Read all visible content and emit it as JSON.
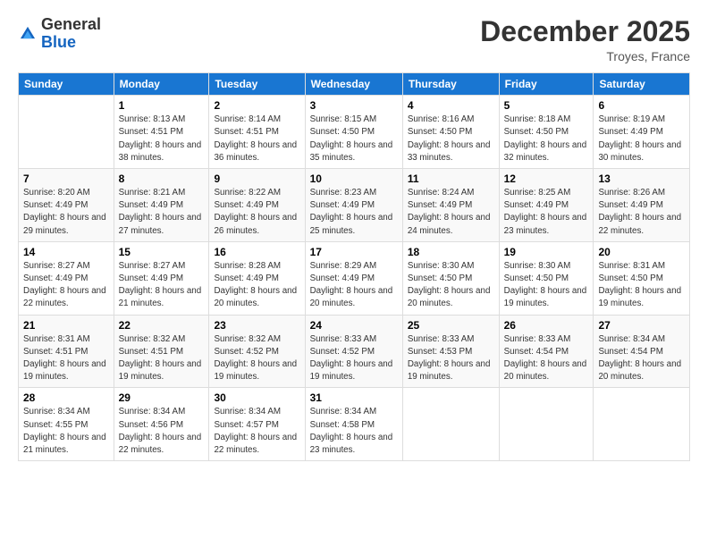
{
  "logo": {
    "general": "General",
    "blue": "Blue"
  },
  "header": {
    "title": "December 2025",
    "location": "Troyes, France"
  },
  "days_of_week": [
    "Sunday",
    "Monday",
    "Tuesday",
    "Wednesday",
    "Thursday",
    "Friday",
    "Saturday"
  ],
  "weeks": [
    [
      {
        "day": null
      },
      {
        "day": "1",
        "sunrise": "Sunrise: 8:13 AM",
        "sunset": "Sunset: 4:51 PM",
        "daylight": "Daylight: 8 hours and 38 minutes."
      },
      {
        "day": "2",
        "sunrise": "Sunrise: 8:14 AM",
        "sunset": "Sunset: 4:51 PM",
        "daylight": "Daylight: 8 hours and 36 minutes."
      },
      {
        "day": "3",
        "sunrise": "Sunrise: 8:15 AM",
        "sunset": "Sunset: 4:50 PM",
        "daylight": "Daylight: 8 hours and 35 minutes."
      },
      {
        "day": "4",
        "sunrise": "Sunrise: 8:16 AM",
        "sunset": "Sunset: 4:50 PM",
        "daylight": "Daylight: 8 hours and 33 minutes."
      },
      {
        "day": "5",
        "sunrise": "Sunrise: 8:18 AM",
        "sunset": "Sunset: 4:50 PM",
        "daylight": "Daylight: 8 hours and 32 minutes."
      },
      {
        "day": "6",
        "sunrise": "Sunrise: 8:19 AM",
        "sunset": "Sunset: 4:49 PM",
        "daylight": "Daylight: 8 hours and 30 minutes."
      }
    ],
    [
      {
        "day": "7",
        "sunrise": "Sunrise: 8:20 AM",
        "sunset": "Sunset: 4:49 PM",
        "daylight": "Daylight: 8 hours and 29 minutes."
      },
      {
        "day": "8",
        "sunrise": "Sunrise: 8:21 AM",
        "sunset": "Sunset: 4:49 PM",
        "daylight": "Daylight: 8 hours and 27 minutes."
      },
      {
        "day": "9",
        "sunrise": "Sunrise: 8:22 AM",
        "sunset": "Sunset: 4:49 PM",
        "daylight": "Daylight: 8 hours and 26 minutes."
      },
      {
        "day": "10",
        "sunrise": "Sunrise: 8:23 AM",
        "sunset": "Sunset: 4:49 PM",
        "daylight": "Daylight: 8 hours and 25 minutes."
      },
      {
        "day": "11",
        "sunrise": "Sunrise: 8:24 AM",
        "sunset": "Sunset: 4:49 PM",
        "daylight": "Daylight: 8 hours and 24 minutes."
      },
      {
        "day": "12",
        "sunrise": "Sunrise: 8:25 AM",
        "sunset": "Sunset: 4:49 PM",
        "daylight": "Daylight: 8 hours and 23 minutes."
      },
      {
        "day": "13",
        "sunrise": "Sunrise: 8:26 AM",
        "sunset": "Sunset: 4:49 PM",
        "daylight": "Daylight: 8 hours and 22 minutes."
      }
    ],
    [
      {
        "day": "14",
        "sunrise": "Sunrise: 8:27 AM",
        "sunset": "Sunset: 4:49 PM",
        "daylight": "Daylight: 8 hours and 22 minutes."
      },
      {
        "day": "15",
        "sunrise": "Sunrise: 8:27 AM",
        "sunset": "Sunset: 4:49 PM",
        "daylight": "Daylight: 8 hours and 21 minutes."
      },
      {
        "day": "16",
        "sunrise": "Sunrise: 8:28 AM",
        "sunset": "Sunset: 4:49 PM",
        "daylight": "Daylight: 8 hours and 20 minutes."
      },
      {
        "day": "17",
        "sunrise": "Sunrise: 8:29 AM",
        "sunset": "Sunset: 4:49 PM",
        "daylight": "Daylight: 8 hours and 20 minutes."
      },
      {
        "day": "18",
        "sunrise": "Sunrise: 8:30 AM",
        "sunset": "Sunset: 4:50 PM",
        "daylight": "Daylight: 8 hours and 20 minutes."
      },
      {
        "day": "19",
        "sunrise": "Sunrise: 8:30 AM",
        "sunset": "Sunset: 4:50 PM",
        "daylight": "Daylight: 8 hours and 19 minutes."
      },
      {
        "day": "20",
        "sunrise": "Sunrise: 8:31 AM",
        "sunset": "Sunset: 4:50 PM",
        "daylight": "Daylight: 8 hours and 19 minutes."
      }
    ],
    [
      {
        "day": "21",
        "sunrise": "Sunrise: 8:31 AM",
        "sunset": "Sunset: 4:51 PM",
        "daylight": "Daylight: 8 hours and 19 minutes."
      },
      {
        "day": "22",
        "sunrise": "Sunrise: 8:32 AM",
        "sunset": "Sunset: 4:51 PM",
        "daylight": "Daylight: 8 hours and 19 minutes."
      },
      {
        "day": "23",
        "sunrise": "Sunrise: 8:32 AM",
        "sunset": "Sunset: 4:52 PM",
        "daylight": "Daylight: 8 hours and 19 minutes."
      },
      {
        "day": "24",
        "sunrise": "Sunrise: 8:33 AM",
        "sunset": "Sunset: 4:52 PM",
        "daylight": "Daylight: 8 hours and 19 minutes."
      },
      {
        "day": "25",
        "sunrise": "Sunrise: 8:33 AM",
        "sunset": "Sunset: 4:53 PM",
        "daylight": "Daylight: 8 hours and 19 minutes."
      },
      {
        "day": "26",
        "sunrise": "Sunrise: 8:33 AM",
        "sunset": "Sunset: 4:54 PM",
        "daylight": "Daylight: 8 hours and 20 minutes."
      },
      {
        "day": "27",
        "sunrise": "Sunrise: 8:34 AM",
        "sunset": "Sunset: 4:54 PM",
        "daylight": "Daylight: 8 hours and 20 minutes."
      }
    ],
    [
      {
        "day": "28",
        "sunrise": "Sunrise: 8:34 AM",
        "sunset": "Sunset: 4:55 PM",
        "daylight": "Daylight: 8 hours and 21 minutes."
      },
      {
        "day": "29",
        "sunrise": "Sunrise: 8:34 AM",
        "sunset": "Sunset: 4:56 PM",
        "daylight": "Daylight: 8 hours and 22 minutes."
      },
      {
        "day": "30",
        "sunrise": "Sunrise: 8:34 AM",
        "sunset": "Sunset: 4:57 PM",
        "daylight": "Daylight: 8 hours and 22 minutes."
      },
      {
        "day": "31",
        "sunrise": "Sunrise: 8:34 AM",
        "sunset": "Sunset: 4:58 PM",
        "daylight": "Daylight: 8 hours and 23 minutes."
      },
      {
        "day": null
      },
      {
        "day": null
      },
      {
        "day": null
      }
    ]
  ]
}
